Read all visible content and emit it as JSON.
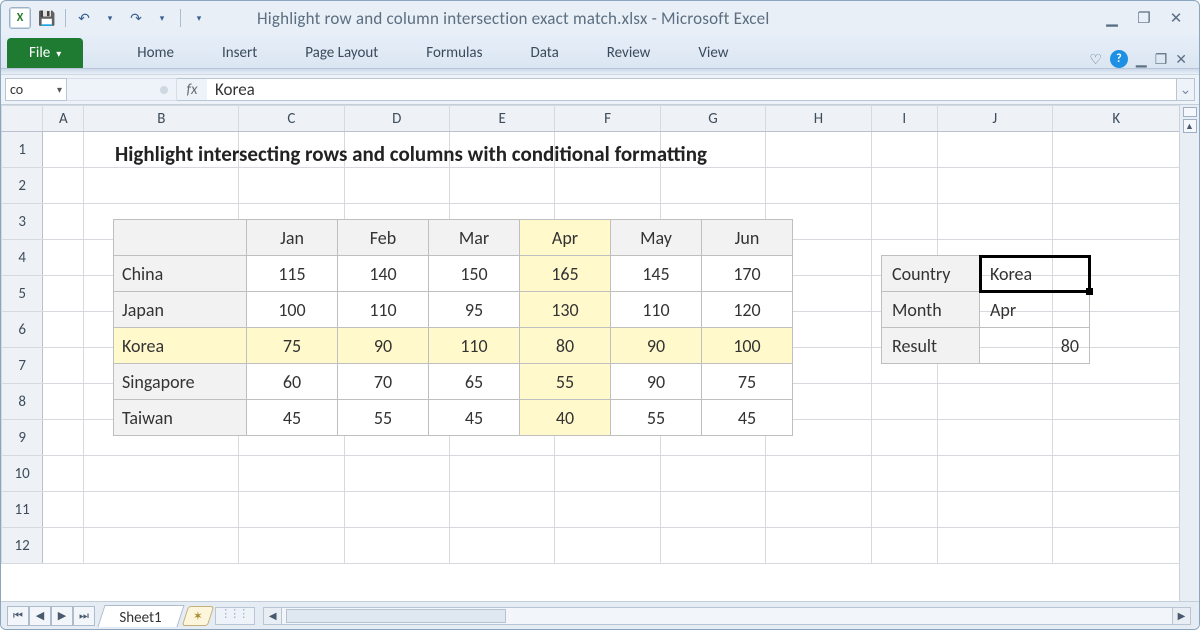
{
  "titlebar": {
    "app_icon_letter": "X",
    "doc_title": "Highlight row and column intersection exact match.xlsx  -  Microsoft Excel"
  },
  "qat": {
    "save": "💾",
    "undo": "↶",
    "undo_dd": "▾",
    "redo": "↷",
    "redo_dd": "▾",
    "custom_dd": "▾"
  },
  "window_controls": {
    "min": "▁",
    "max": "❐",
    "close": "✕"
  },
  "ribbon": {
    "file": "File",
    "tabs": [
      "Home",
      "Insert",
      "Page Layout",
      "Formulas",
      "Data",
      "Review",
      "View"
    ],
    "help": "?",
    "ws_min": "▁",
    "ws_max": "❐",
    "ws_close": "✕",
    "heart": "♡"
  },
  "fx": {
    "namebox": "co",
    "namebox_dd": "▾",
    "fx_label": "fx",
    "formula": "Korea",
    "expand": "⌄"
  },
  "grid": {
    "cols": [
      "A",
      "B",
      "C",
      "D",
      "E",
      "F",
      "G",
      "H",
      "I",
      "J",
      "K"
    ],
    "rows": [
      "1",
      "2",
      "3",
      "4",
      "5",
      "6",
      "7",
      "8",
      "9",
      "10",
      "11",
      "12"
    ],
    "active_row_header": "5",
    "active_col_header": "K"
  },
  "content": {
    "heading": "Highlight intersecting rows and columns with conditional formatting",
    "months": [
      "Jan",
      "Feb",
      "Mar",
      "Apr",
      "May",
      "Jun"
    ],
    "countries": [
      "China",
      "Japan",
      "Korea",
      "Singapore",
      "Taiwan"
    ],
    "values": [
      [
        115,
        140,
        150,
        165,
        145,
        170
      ],
      [
        100,
        110,
        95,
        130,
        110,
        120
      ],
      [
        75,
        90,
        110,
        80,
        90,
        100
      ],
      [
        60,
        70,
        65,
        55,
        90,
        75
      ],
      [
        45,
        55,
        45,
        40,
        55,
        45
      ]
    ],
    "highlight_row": "Korea",
    "highlight_col": "Apr"
  },
  "lookup": {
    "labels": {
      "country": "Country",
      "month": "Month",
      "result": "Result"
    },
    "country": "Korea",
    "month": "Apr",
    "result": 80
  },
  "sheetbar": {
    "sheet": "Sheet1",
    "nav": {
      "first": "⏮",
      "prev": "◀",
      "next": "▶",
      "last": "⏭"
    },
    "newsheet": "✶",
    "scroll_up": "▲"
  },
  "chart_data": {
    "type": "table",
    "title": "Highlight intersecting rows and columns with conditional formatting",
    "categories": [
      "Jan",
      "Feb",
      "Mar",
      "Apr",
      "May",
      "Jun"
    ],
    "series": [
      {
        "name": "China",
        "values": [
          115,
          140,
          150,
          165,
          145,
          170
        ]
      },
      {
        "name": "Japan",
        "values": [
          100,
          110,
          95,
          130,
          110,
          120
        ]
      },
      {
        "name": "Korea",
        "values": [
          75,
          90,
          110,
          80,
          90,
          100
        ]
      },
      {
        "name": "Singapore",
        "values": [
          60,
          70,
          65,
          55,
          90,
          75
        ]
      },
      {
        "name": "Taiwan",
        "values": [
          45,
          55,
          45,
          40,
          55,
          45
        ]
      }
    ],
    "lookup": {
      "Country": "Korea",
      "Month": "Apr",
      "Result": 80
    }
  }
}
